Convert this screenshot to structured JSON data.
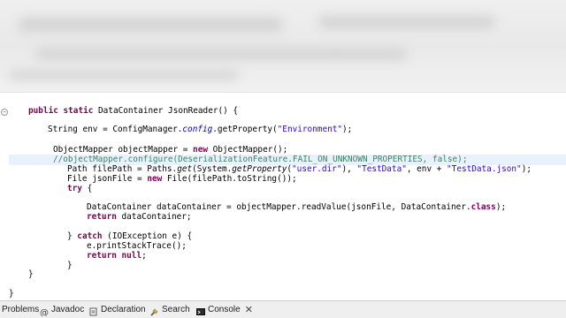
{
  "editor": {
    "lines": [
      {
        "id": "l1",
        "segments": [
          {
            "t": "public static ",
            "c": "kw"
          },
          {
            "t": "DataContainer JsonReader() {",
            "c": ""
          }
        ]
      },
      {
        "id": "l2",
        "segments": [
          {
            "t": "String env = ConfigManager.",
            "c": ""
          },
          {
            "t": "config",
            "c": "field"
          },
          {
            "t": ".getProperty(",
            "c": ""
          },
          {
            "t": "\"Environment\"",
            "c": "str"
          },
          {
            "t": ");",
            "c": ""
          }
        ]
      },
      {
        "id": "l3",
        "segments": [
          {
            "t": "ObjectMapper objectMapper = ",
            "c": ""
          },
          {
            "t": "new ",
            "c": "kw"
          },
          {
            "t": "ObjectMapper();",
            "c": ""
          }
        ]
      },
      {
        "id": "l4",
        "segments": [
          {
            "t": "//objectMapper.configure(DeserializationFeature.FAIL_ON_UNKNOWN_PROPERTIES, false);",
            "c": "comment"
          }
        ]
      },
      {
        "id": "l5",
        "segments": [
          {
            "t": "Path filePath = Paths.",
            "c": ""
          },
          {
            "t": "get",
            "c": "it"
          },
          {
            "t": "(System.",
            "c": ""
          },
          {
            "t": "getProperty",
            "c": "it"
          },
          {
            "t": "(",
            "c": ""
          },
          {
            "t": "\"user.dir\"",
            "c": "str"
          },
          {
            "t": "), ",
            "c": ""
          },
          {
            "t": "\"TestData\"",
            "c": "str"
          },
          {
            "t": ", env + ",
            "c": ""
          },
          {
            "t": "\"TestData.json\"",
            "c": "str"
          },
          {
            "t": ");",
            "c": ""
          }
        ]
      },
      {
        "id": "l6",
        "segments": [
          {
            "t": "File jsonFile = ",
            "c": ""
          },
          {
            "t": "new ",
            "c": "kw"
          },
          {
            "t": "File(filePath.toString());",
            "c": ""
          }
        ]
      },
      {
        "id": "l7",
        "segments": [
          {
            "t": "try ",
            "c": "kw"
          },
          {
            "t": "{",
            "c": ""
          }
        ]
      },
      {
        "id": "l8",
        "segments": [
          {
            "t": "DataContainer dataContainer = objectMapper.readValue(jsonFile, DataContainer.",
            "c": ""
          },
          {
            "t": "class",
            "c": "kw"
          },
          {
            "t": ");",
            "c": ""
          }
        ]
      },
      {
        "id": "l9",
        "segments": [
          {
            "t": "return ",
            "c": "kw"
          },
          {
            "t": "dataContainer;",
            "c": ""
          }
        ]
      },
      {
        "id": "l10",
        "segments": [
          {
            "t": "} ",
            "c": ""
          },
          {
            "t": "catch ",
            "c": "kw"
          },
          {
            "t": "(IOException e) {",
            "c": ""
          }
        ]
      },
      {
        "id": "l11",
        "segments": [
          {
            "t": "e.printStackTrace();",
            "c": ""
          }
        ]
      },
      {
        "id": "l12",
        "segments": [
          {
            "t": "return null",
            "c": "kw"
          },
          {
            "t": ";",
            "c": ""
          }
        ]
      },
      {
        "id": "l13",
        "segments": [
          {
            "t": "}",
            "c": ""
          }
        ]
      },
      {
        "id": "l14",
        "segments": [
          {
            "t": "}",
            "c": ""
          }
        ]
      },
      {
        "id": "l15",
        "segments": [
          {
            "t": "}",
            "c": ""
          }
        ]
      }
    ]
  },
  "tabs": {
    "problems": "Problems",
    "javadoc": "Javadoc",
    "declaration": "Declaration",
    "search": "Search",
    "console": "Console",
    "close": "✕"
  },
  "colors": {
    "keyword": "#7f0055",
    "string": "#2a00ff",
    "comment": "#3f7f5f",
    "static_field": "#0000c0",
    "current_line": "#e8f2fe"
  }
}
